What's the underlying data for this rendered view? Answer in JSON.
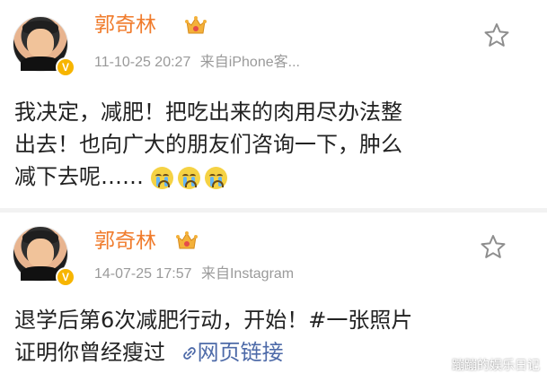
{
  "posts": [
    {
      "author": "郭奇林",
      "timestamp": "11-10-25 20:27",
      "source": "来自iPhone客...",
      "text_lines": [
        "我决定，减肥！把吃出来的肉用尽办法整",
        "出去！也向广大的朋友们咨询一下，肿么",
        "减下去呢……"
      ],
      "emojis": [
        "crying-emoji",
        "crying-emoji",
        "crying-emoji"
      ]
    },
    {
      "author": "郭奇林",
      "timestamp": "14-07-25 17:57",
      "source": "来自Instagram",
      "text_lines": [
        "退学后第6次减肥行动，开始！#一张照片",
        "证明你曾经瘦过"
      ],
      "link_label": "网页链接",
      "link_icon": "link-icon"
    }
  ],
  "watermark": "蹦蹦的娱乐日记",
  "colors": {
    "name": "#f07b2b",
    "meta": "#9a9a9a",
    "text": "#222222",
    "link": "#4d6aa8",
    "badge": "#f7b500",
    "separator": "#f2f2f2"
  }
}
